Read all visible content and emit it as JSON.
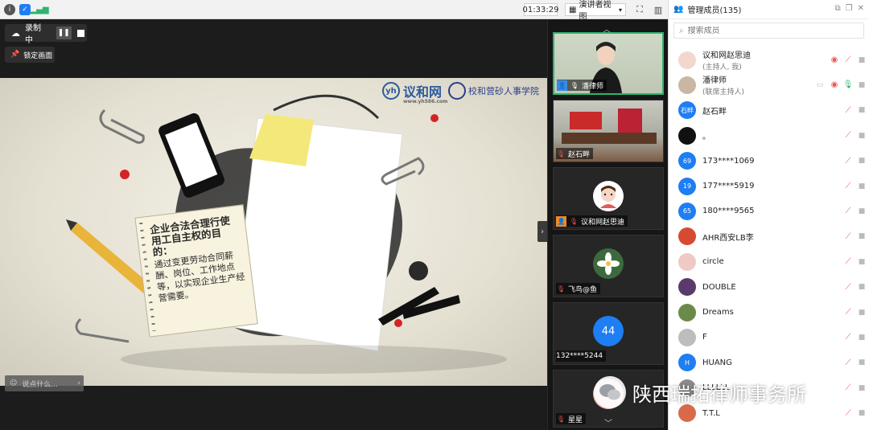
{
  "topbar": {
    "timer": "01:33:29",
    "view_label": "演讲者视图",
    "colors": {
      "info": "#555555",
      "shield": "#1e7ef3",
      "signal": "#2fb36e"
    }
  },
  "stage": {
    "recording_label": "录制中",
    "pin_label": "锁定画面",
    "chat_placeholder": "说点什么..."
  },
  "slide": {
    "logo_main": "议和网",
    "logo_url": "www.yh586.com",
    "logo_school": "校和营砂人事学院",
    "note_title": "企业合法合理行使用工自主权的目的：",
    "note_body": "通过变更劳动合同薪酬、岗位、工作地点等，以实现企业生产经营需要。"
  },
  "videos": [
    {
      "name": "潘律师",
      "type": "camera",
      "active": true
    },
    {
      "name": "赵石畔",
      "type": "room"
    },
    {
      "name": "议和网赵思迪",
      "type": "avatar"
    },
    {
      "name": "飞鸟@鱼",
      "type": "flower"
    },
    {
      "name": "132****5244",
      "type": "number",
      "badge": "44"
    },
    {
      "name": "星星",
      "type": "avatar2"
    }
  ],
  "panel": {
    "title": "管理成员(135)",
    "search_placeholder": "搜索成员",
    "members": [
      {
        "name": "议和网赵思迪",
        "role": "(主持人, 我)",
        "avatar_text": "",
        "avatar_color": "#f3d7cf"
      },
      {
        "name": "潘律师",
        "role": "(联席主持人)",
        "avatar_text": "",
        "avatar_color": "#c9b7a3"
      },
      {
        "name": "赵石畔",
        "role": "",
        "avatar_text": "石畔",
        "avatar_color": "#1e7ef3"
      },
      {
        "name": "。",
        "role": "",
        "avatar_text": "",
        "avatar_color": "#111111"
      },
      {
        "name": "173****1069",
        "role": "",
        "avatar_text": "69",
        "avatar_color": "#1e7ef3"
      },
      {
        "name": "177****5919",
        "role": "",
        "avatar_text": "19",
        "avatar_color": "#1e7ef3"
      },
      {
        "name": "180****9565",
        "role": "",
        "avatar_text": "65",
        "avatar_color": "#1e7ef3"
      },
      {
        "name": "AHR西安LB李",
        "role": "",
        "avatar_text": "",
        "avatar_color": "#d64a32"
      },
      {
        "name": "circle",
        "role": "",
        "avatar_text": "",
        "avatar_color": "#f0c9c4"
      },
      {
        "name": "DOUBLE",
        "role": "",
        "avatar_text": "",
        "avatar_color": "#5a3a6a"
      },
      {
        "name": "Dreams",
        "role": "",
        "avatar_text": "",
        "avatar_color": "#6a8a4a"
      },
      {
        "name": "F",
        "role": "",
        "avatar_text": "",
        "avatar_color": "#bdbdbd"
      },
      {
        "name": "HUANG",
        "role": "",
        "avatar_text": "H",
        "avatar_color": "#1e7ef3"
      },
      {
        "name": "LLLLLL",
        "role": "",
        "avatar_text": "",
        "avatar_color": "#8a8a8a"
      },
      {
        "name": "T.T.L",
        "role": "",
        "avatar_text": "",
        "avatar_color": "#d86a4a"
      }
    ]
  },
  "watermark": {
    "text": "陕西瑞拓律师事务所"
  }
}
